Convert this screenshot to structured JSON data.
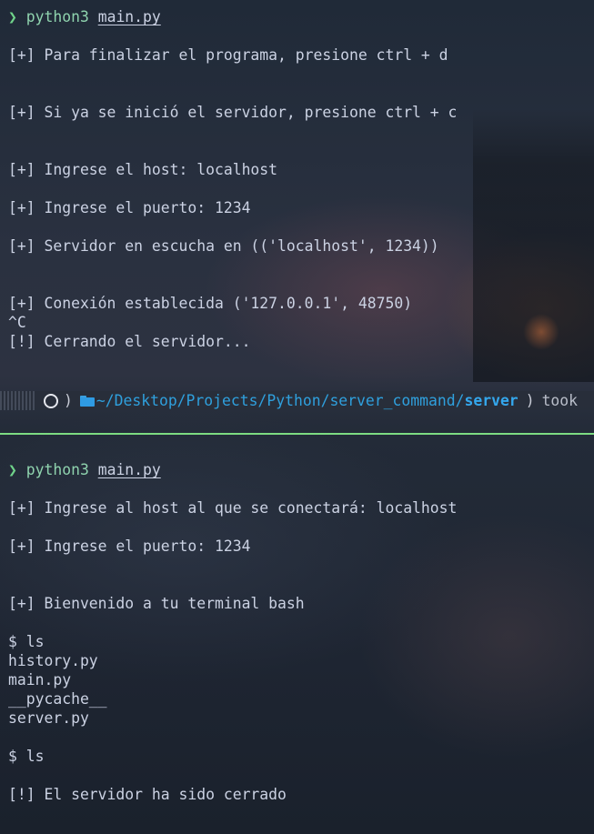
{
  "top_pane": {
    "prompt_symbol": "❯",
    "command": "python3",
    "file": "main.py",
    "lines": [
      "[+] Para finalizar el programa, presione ctrl + d",
      "[+] Si ya se inició el servidor, presione ctrl + c",
      "[+] Ingrese el host: localhost",
      "[+] Ingrese el puerto: 1234",
      "[+] Servidor en escucha en (('localhost', 1234))",
      "[+] Conexión establecida ('127.0.0.1', 48750)",
      "^C",
      "[!] Cerrando el servidor..."
    ],
    "statusbar": {
      "os_icon": "debian-swirl-icon",
      "folder_icon": "folder-open-icon",
      "path": "~/Desktop/Projects/Python/server_command/",
      "path_current": "server",
      "took": "took"
    }
  },
  "bottom_pane": {
    "prompt_symbol": "❯",
    "command": "python3",
    "file": "main.py",
    "lines": [
      "[+] Ingrese al host al que se conectará: localhost",
      "[+] Ingrese el puerto: 1234",
      "[+] Bienvenido a tu terminal bash",
      "$ ls",
      "history.py",
      "main.py",
      "__pycache__",
      "server.py",
      "$ ls",
      "[!] El servidor ha sido cerrado"
    ]
  },
  "colors": {
    "divider": "#7ddc82",
    "prompt": "#6fd38a",
    "path": "#2fa0dd"
  }
}
